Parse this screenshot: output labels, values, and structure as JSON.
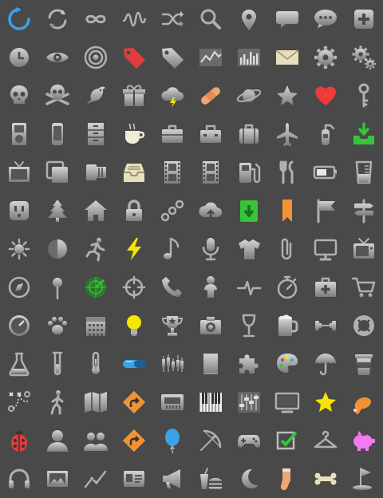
{
  "grid": {
    "columns": 10,
    "rows": 13
  },
  "colors": {
    "background": "#494949",
    "icon_light": "#c4c4c4",
    "icon_dark": "#6e6e6e",
    "refresh_blue": "#3aa3e6",
    "tag_red": "#e23c3c",
    "heart_red": "#f03a3a",
    "green": "#35c43a",
    "yellow": "#f5e600",
    "orange": "#f39233",
    "pink": "#f07cf0"
  },
  "icons": [
    {
      "name": "refresh-icon",
      "color": "#3aa3e6"
    },
    {
      "name": "sync-icon"
    },
    {
      "name": "loop-icon"
    },
    {
      "name": "wave-icon"
    },
    {
      "name": "shuffle-icon"
    },
    {
      "name": "search-icon"
    },
    {
      "name": "map-pin-icon"
    },
    {
      "name": "speech-bubble-icon"
    },
    {
      "name": "chat-dots-icon"
    },
    {
      "name": "plus-box-icon"
    },
    {
      "name": "clock-icon"
    },
    {
      "name": "eye-icon"
    },
    {
      "name": "target-icon"
    },
    {
      "name": "price-tag-red-icon",
      "color": "#e23c3c"
    },
    {
      "name": "price-tag-icon"
    },
    {
      "name": "line-chart-icon"
    },
    {
      "name": "bar-chart-icon"
    },
    {
      "name": "envelope-icon",
      "color": "#e8e0bd"
    },
    {
      "name": "gear-icon"
    },
    {
      "name": "gears-icon"
    },
    {
      "name": "skull-icon"
    },
    {
      "name": "skull-crossbones-icon"
    },
    {
      "name": "bird-icon"
    },
    {
      "name": "gift-icon"
    },
    {
      "name": "storm-cloud-icon"
    },
    {
      "name": "bandage-icon",
      "color": "#f2a574"
    },
    {
      "name": "planet-icon"
    },
    {
      "name": "star-icon"
    },
    {
      "name": "heart-icon",
      "color": "#f03a3a"
    },
    {
      "name": "key-icon"
    },
    {
      "name": "ipod-icon"
    },
    {
      "name": "phone-icon"
    },
    {
      "name": "filing-cabinet-icon"
    },
    {
      "name": "coffee-cup-icon",
      "color": "#f0ecd6"
    },
    {
      "name": "briefcase-icon"
    },
    {
      "name": "toolbox-icon"
    },
    {
      "name": "suitcase-icon"
    },
    {
      "name": "airplane-icon"
    },
    {
      "name": "fire-extinguisher-icon"
    },
    {
      "name": "download-tray-icon",
      "color": "#35c43a"
    },
    {
      "name": "tv-frame-icon"
    },
    {
      "name": "copy-icon"
    },
    {
      "name": "film-roll-icon"
    },
    {
      "name": "inbox-icon",
      "color": "#e8e0bd"
    },
    {
      "name": "film-strip-icon"
    },
    {
      "name": "film-strip-2-icon"
    },
    {
      "name": "gas-pump-icon"
    },
    {
      "name": "fork-knife-icon"
    },
    {
      "name": "battery-icon"
    },
    {
      "name": "measuring-glass-icon"
    },
    {
      "name": "power-outlet-icon"
    },
    {
      "name": "tree-icon"
    },
    {
      "name": "house-icon"
    },
    {
      "name": "padlock-icon"
    },
    {
      "name": "chain-link-icon"
    },
    {
      "name": "cloud-upload-icon"
    },
    {
      "name": "download-green-icon",
      "color": "#35c43a"
    },
    {
      "name": "bookmark-ribbon-icon",
      "color": "#f39233"
    },
    {
      "name": "flag-icon"
    },
    {
      "name": "signpost-icon"
    },
    {
      "name": "sun-icon"
    },
    {
      "name": "moon-phase-icon"
    },
    {
      "name": "runner-icon"
    },
    {
      "name": "lightning-icon",
      "color": "#f5e600"
    },
    {
      "name": "music-note-icon"
    },
    {
      "name": "microphone-icon"
    },
    {
      "name": "t-shirt-icon"
    },
    {
      "name": "paperclip-icon"
    },
    {
      "name": "monitor-icon"
    },
    {
      "name": "retro-tv-icon"
    },
    {
      "name": "compass-icon"
    },
    {
      "name": "push-pin-icon"
    },
    {
      "name": "radar-icon",
      "color": "#35c43a"
    },
    {
      "name": "crosshair-icon"
    },
    {
      "name": "telephone-handset-icon"
    },
    {
      "name": "baby-icon"
    },
    {
      "name": "heartbeat-icon"
    },
    {
      "name": "stopwatch-icon"
    },
    {
      "name": "first-aid-kit-icon"
    },
    {
      "name": "shopping-cart-icon"
    },
    {
      "name": "speedometer-icon"
    },
    {
      "name": "paw-icon"
    },
    {
      "name": "calendar-icon"
    },
    {
      "name": "light-bulb-icon",
      "color": "#f5e600"
    },
    {
      "name": "trophy-icon"
    },
    {
      "name": "camera-icon"
    },
    {
      "name": "wine-glass-icon"
    },
    {
      "name": "beer-mug-icon"
    },
    {
      "name": "dumbbell-icon"
    },
    {
      "name": "life-buoy-icon"
    },
    {
      "name": "flask-icon"
    },
    {
      "name": "test-tube-icon"
    },
    {
      "name": "thermometer-icon"
    },
    {
      "name": "pill-icon",
      "color": "#3aa3e6"
    },
    {
      "name": "candlestick-chart-icon"
    },
    {
      "name": "book-icon"
    },
    {
      "name": "puzzle-piece-icon"
    },
    {
      "name": "paint-palette-icon"
    },
    {
      "name": "umbrella-icon"
    },
    {
      "name": "takeaway-cup-icon"
    },
    {
      "name": "playbook-icon"
    },
    {
      "name": "walker-icon"
    },
    {
      "name": "map-icon"
    },
    {
      "name": "road-sign-icon",
      "color": "#f39233"
    },
    {
      "name": "cassette-icon"
    },
    {
      "name": "piano-keys-icon"
    },
    {
      "name": "equalizer-icon"
    },
    {
      "name": "widescreen-tv-icon"
    },
    {
      "name": "sheriff-star-icon",
      "color": "#f5e600"
    },
    {
      "name": "drumstick-icon",
      "color": "#f39233"
    },
    {
      "name": "ladybug-icon",
      "color": "#e23c3c"
    },
    {
      "name": "person-icon"
    },
    {
      "name": "group-icon"
    },
    {
      "name": "turn-sign-icon",
      "color": "#f39233"
    },
    {
      "name": "balloon-icon",
      "color": "#3aa3e6"
    },
    {
      "name": "bow-arrow-icon"
    },
    {
      "name": "gamepad-icon"
    },
    {
      "name": "checkbox-icon",
      "color": "#35c43a"
    },
    {
      "name": "hanger-icon"
    },
    {
      "name": "piggy-bank-icon",
      "color": "#f07cf0"
    },
    {
      "name": "headphones-icon"
    },
    {
      "name": "picture-icon"
    },
    {
      "name": "trend-line-icon"
    },
    {
      "name": "id-card-icon"
    },
    {
      "name": "megaphone-icon"
    },
    {
      "name": "fast-food-icon"
    },
    {
      "name": "crescent-moon-icon"
    },
    {
      "name": "sock-icon",
      "color": "#f2a574"
    },
    {
      "name": "bone-icon",
      "color": "#e8e0bd"
    },
    {
      "name": "golf-flag-icon"
    }
  ]
}
